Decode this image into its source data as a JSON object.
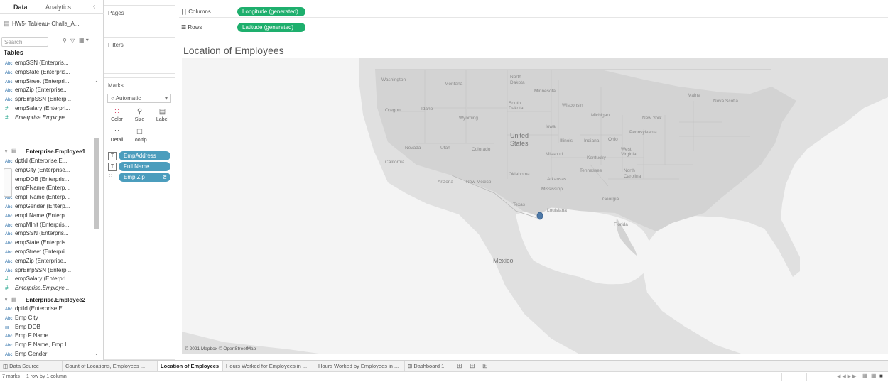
{
  "data_pane": {
    "tab_data": "Data",
    "tab_analytics": "Analytics",
    "datasource": "HW5- Tableau- Challa_A...",
    "search_placeholder": "Search",
    "tables_label": "Tables",
    "group0_fields": [
      {
        "type": "Abc",
        "name": "empSSN (Enterpris..."
      },
      {
        "type": "Abc",
        "name": "empState (Enterpris..."
      },
      {
        "type": "Abc",
        "name": "empStreet (Enterpri..."
      },
      {
        "type": "Abc",
        "name": "empZip (Enterprise..."
      },
      {
        "type": "Abc",
        "name": "sprEmpSSN (Enterp..."
      },
      {
        "type": "#",
        "name": "empSalary (Enterpri..."
      },
      {
        "type": "#",
        "name": "Enterprise.Employe..."
      }
    ],
    "group1_name": "Enterprise.Employee1",
    "group1_fields": [
      {
        "type": "Abc",
        "name": "dptId (Enterprise.E..."
      },
      {
        "type": "Abc",
        "name": "empCity (Enterprise..."
      },
      {
        "type": "cal",
        "name": "empDOB (Enterpris..."
      },
      {
        "type": "Abc",
        "name": "empFName (Enterp..."
      },
      {
        "type": "Abc",
        "name": "empFName (Enterp..."
      },
      {
        "type": "Abc",
        "name": "empGender (Enterp..."
      },
      {
        "type": "Abc",
        "name": "empLName (Enterp..."
      },
      {
        "type": "Abc",
        "name": "empMInit (Enterpris..."
      },
      {
        "type": "Abc",
        "name": "empSSN (Enterpris..."
      },
      {
        "type": "Abc",
        "name": "empState (Enterpris..."
      },
      {
        "type": "Abc",
        "name": "empStreet (Enterpri..."
      },
      {
        "type": "Abc",
        "name": "empZip (Enterprise..."
      },
      {
        "type": "Abc",
        "name": "sprEmpSSN (Enterp..."
      },
      {
        "type": "#",
        "name": "empSalary (Enterpri..."
      },
      {
        "type": "#",
        "name": "Enterprise.Employe..."
      }
    ],
    "group2_name": "Enterprise.Employee2",
    "group2_fields": [
      {
        "type": "Abc",
        "name": "dptId (Enterprise.E..."
      },
      {
        "type": "Abc",
        "name": "Emp City"
      },
      {
        "type": "cal",
        "name": "Emp DOB"
      },
      {
        "type": "Abc",
        "name": "Emp F Name"
      },
      {
        "type": "Abc",
        "name": "Emp F Name, Emp L..."
      },
      {
        "type": "Abc",
        "name": "Emp Gender"
      }
    ]
  },
  "cards": {
    "pages": "Pages",
    "filters": "Filters",
    "marks": "Marks",
    "mark_type": "Automatic",
    "color": "Color",
    "size": "Size",
    "label": "Label",
    "detail": "Detail",
    "tooltip": "Tooltip",
    "pills": [
      "EmpAddress",
      "Full Name",
      "Emp Zip"
    ]
  },
  "shelves": {
    "columns_label": "Columns",
    "columns_pill": "Longitude (generated)",
    "rows_label": "Rows",
    "rows_pill": "Latitude (generated)"
  },
  "viz": {
    "title": "Location of Employees",
    "attribution": "© 2021 Mapbox © OpenStreetMap",
    "labels": {
      "washington": "Washington",
      "montana": "Montana",
      "north_dakota": "North\nDakota",
      "minnesota": "Minnesota",
      "south_dakota": "South\nDakota",
      "wisconsin": "Wisconsin",
      "oregon": "Oregon",
      "idaho": "Idaho",
      "wyoming": "Wyoming",
      "iowa": "Iowa",
      "michigan": "Michigan",
      "new_york": "New York",
      "nevada": "Nevada",
      "utah": "Utah",
      "colorado": "Colorado",
      "united_states": "United\nStates",
      "illinois": "Illinois",
      "indiana": "Indiana",
      "ohio": "Ohio",
      "pennsylvania": "Pennsylvania",
      "maine": "Maine",
      "nova_scotia": "Nova Scotia",
      "california": "California",
      "missouri": "Missouri",
      "kentucky": "Kentucky",
      "west_virginia": "West\nVirginia",
      "tennessee": "Tennessee",
      "north_carolina": "North\nCarolina",
      "oklahoma": "Oklahoma",
      "arkansas": "Arkansas",
      "arizona": "Arizona",
      "new_mexico": "New Mexico",
      "mississippi": "Mississippi",
      "texas": "Texas",
      "louisiana": "Louisiana",
      "georgia": "Georgia",
      "florida": "Florida",
      "mexico": "Mexico"
    },
    "marks": [
      {
        "lon": -95.4,
        "lat": 29.8
      }
    ]
  },
  "tabs": {
    "data_source": "Data Source",
    "sheet1": "Count of Locations, Employees ...",
    "sheet2": "Location of Employees",
    "sheet3": "Hours Worked for Employees in ...",
    "sheet4": "Hours Worked by Employees in ...",
    "dashboard": "Dashboard 1"
  },
  "status": {
    "marks": "7 marks",
    "dims": "1 row by 1 column"
  }
}
